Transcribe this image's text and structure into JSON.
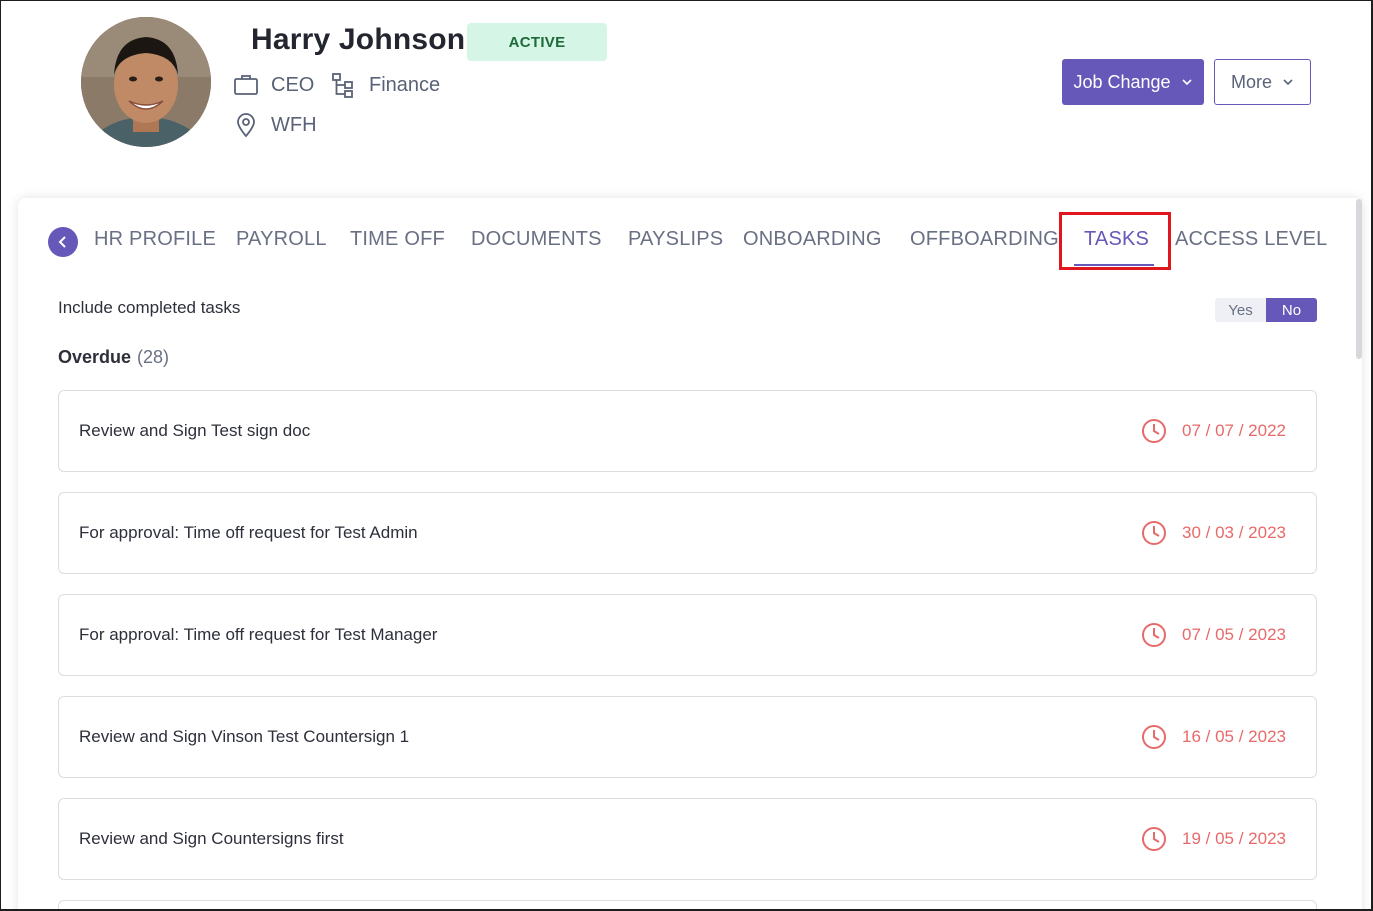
{
  "profile": {
    "name": "Harry Johnson",
    "status": "ACTIVE",
    "job_title": "CEO",
    "department": "Finance",
    "location": "WFH"
  },
  "actions": {
    "job_change_label": "Job Change",
    "more_label": "More"
  },
  "tabs": [
    {
      "label": "HR PROFILE"
    },
    {
      "label": "PAYROLL"
    },
    {
      "label": "TIME OFF"
    },
    {
      "label": "DOCUMENTS"
    },
    {
      "label": "PAYSLIPS"
    },
    {
      "label": "ONBOARDING"
    },
    {
      "label": "OFFBOARDING"
    },
    {
      "label": "TASKS"
    },
    {
      "label": "ACCESS LEVEL"
    }
  ],
  "active_tab": "TASKS",
  "filters": {
    "include_completed_label": "Include completed tasks",
    "yes_label": "Yes",
    "no_label": "No",
    "selected": "No"
  },
  "overdue": {
    "title": "Overdue",
    "count": "(28)",
    "tasks": [
      {
        "title": "Review and Sign Test sign doc",
        "due": "07 / 07 / 2022"
      },
      {
        "title": "For approval: Time off request for Test Admin",
        "due": "30 / 03 / 2023"
      },
      {
        "title": "For approval: Time off request for Test Manager",
        "due": "07 / 05 / 2023"
      },
      {
        "title": "Review and Sign Vinson Test Countersign 1",
        "due": "16 / 05 / 2023"
      },
      {
        "title": "Review and Sign Countersigns first",
        "due": "19 / 05 / 2023"
      }
    ]
  },
  "colors": {
    "accent": "#6558b8",
    "status_bg": "#d5f5e6",
    "overdue": "#e76a6a",
    "highlight": "#e0161f"
  }
}
